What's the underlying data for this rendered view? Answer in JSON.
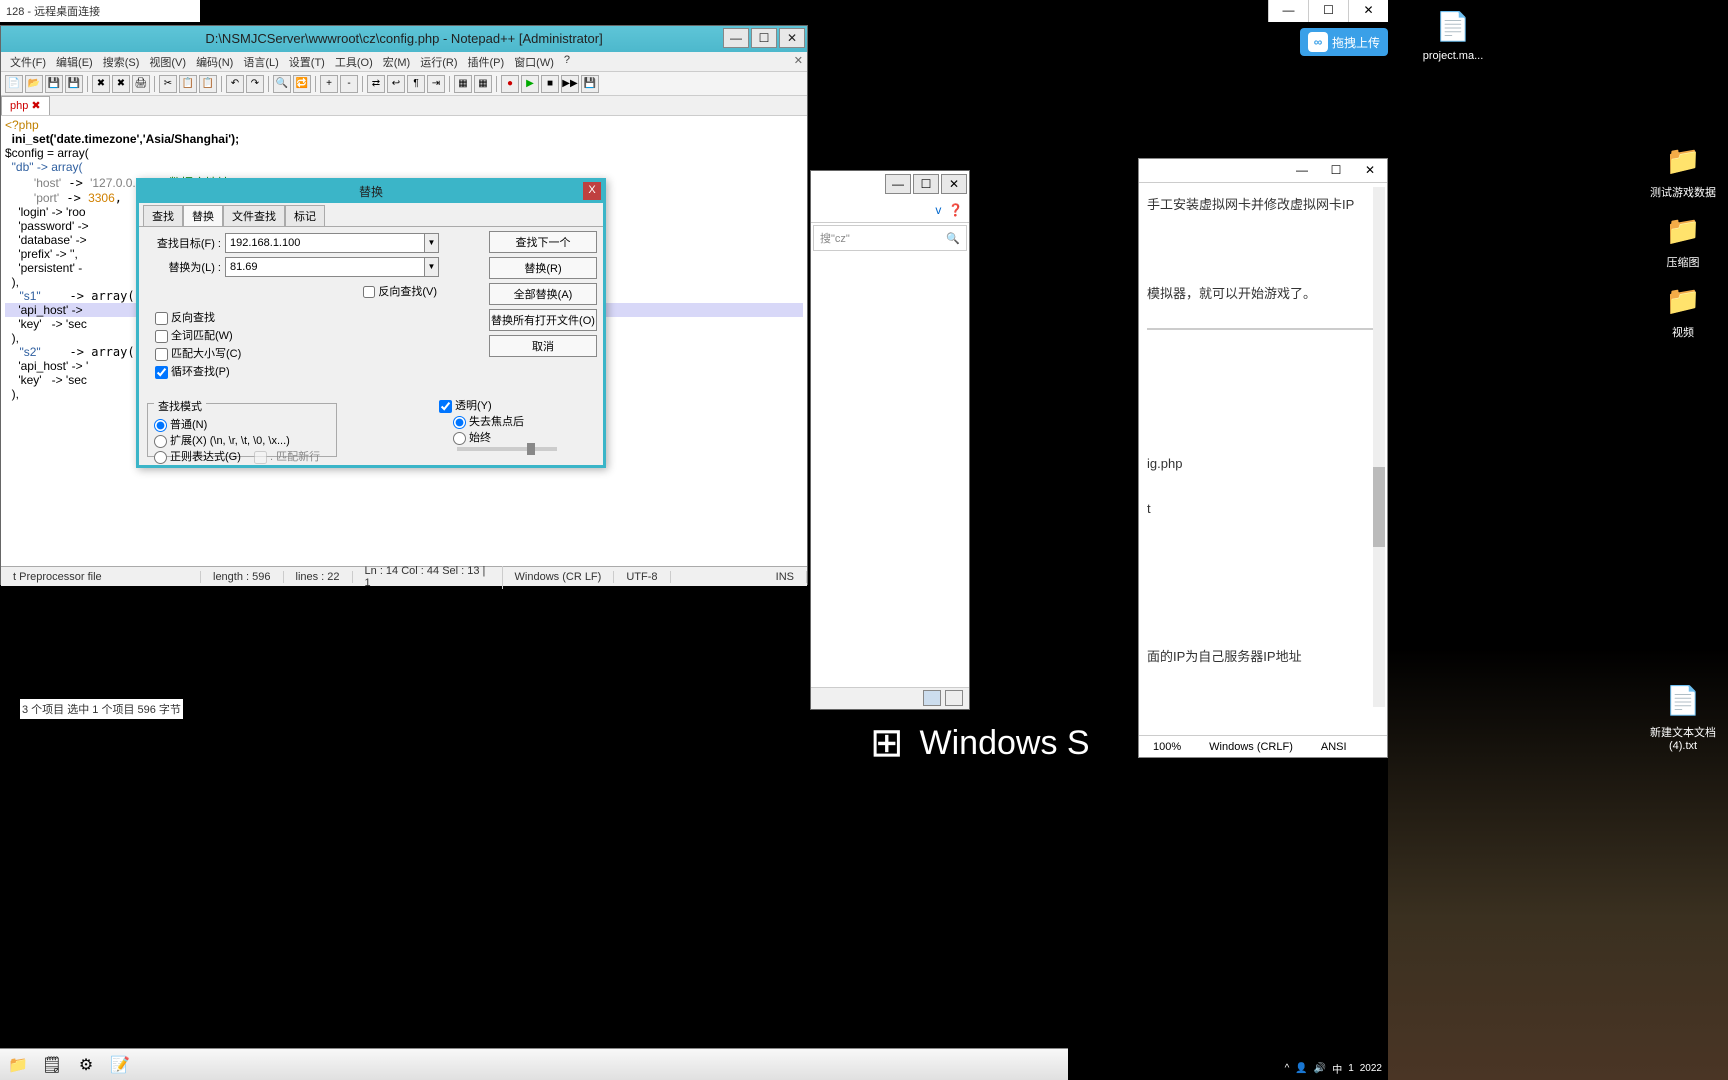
{
  "rdp": {
    "title": "128 - 远程桌面连接"
  },
  "upload": {
    "label": "拖拽上传"
  },
  "desktop_icons": {
    "project": "project.ma...",
    "test_game": "测试游戏数据",
    "compress": "压缩图",
    "video": "视频",
    "newtxt": "新建文本文档(4).txt"
  },
  "npp": {
    "title": "D:\\NSMJCServer\\wwwroot\\cz\\config.php - Notepad++ [Administrator]",
    "menus": [
      "文件(F)",
      "编辑(E)",
      "搜索(S)",
      "视图(V)",
      "编码(N)",
      "语言(L)",
      "设置(T)",
      "工具(O)",
      "宏(M)",
      "运行(R)",
      "插件(P)",
      "窗口(W)",
      "?"
    ],
    "tab": "php",
    "code": {
      "l1": "<?php",
      "l2": "  ini_set('date.timezone','Asia/Shanghai');",
      "l3": "$config = array(",
      "l4": "  \"db\" -> array(",
      "l5": "    'host' -> '127.0.0.1', // 数据库地址",
      "l6": "    'port' -> 3306,",
      "l7": "    'login' -> 'roo",
      "l8": "    'password' ->",
      "l9": "    'database' ->",
      "l10": "    'prefix' -> '',",
      "l11": "    'persistent' -",
      "l12": "  ),",
      "l13": "  \"s1\"    -> array(",
      "l14": "    'api_host' ->",
      "l15": "    'key'   -> 'sec",
      "l16": "  ),",
      "l17": "  \"s2\"    -> array(",
      "l18": "    'api_host' -> '",
      "l19": "    'key'   -> 'sec",
      "l20": "  ),"
    },
    "status": {
      "filetype": "t Preprocessor file",
      "len": "length : 596",
      "lines": "lines : 22",
      "pos": "Ln : 14   Col : 44   Sel : 13 | 1",
      "eol": "Windows (CR LF)",
      "enc": "UTF-8",
      "ins": "INS"
    }
  },
  "dlg": {
    "title": "替换",
    "tabs": [
      "查找",
      "替换",
      "文件查找",
      "标记"
    ],
    "find_label": "查找目标(F) :",
    "replace_label": "替换为(L) :",
    "find_value": "192.168.1.100",
    "replace_value": "81.69",
    "backwards": "反向查找(V)",
    "btn_findnext": "查找下一个",
    "btn_replace": "替换(R)",
    "btn_replaceall": "全部替换(A)",
    "btn_replaceallopen": "替换所有打开文件(O)",
    "btn_cancel": "取消",
    "chk_reverse": "反向查找",
    "chk_wholeword": "全词匹配(W)",
    "chk_case": "匹配大小写(C)",
    "chk_wrap": "循环查找(P)",
    "group_mode": "查找模式",
    "mode_normal": "普通(N)",
    "mode_extended": "扩展(X) (\\n, \\r, \\t, \\0, \\x...)",
    "mode_regex": "正则表达式(G)",
    "mode_dotall": ". 匹配新行",
    "chk_transparent": "透明(Y)",
    "trans_lose": "失去焦点后",
    "trans_always": "始终"
  },
  "explorer": {
    "addr_hint": "v   ❓",
    "search_hint": "搜\"cz\"",
    "status_left": "3 个项目    选中 1 个项目  596 字节"
  },
  "bgnotepad": {
    "line1": "手工安装虚拟网卡并修改虚拟网卡IP",
    "line2": "模拟器，就可以开始游戏了。",
    "line3": "ig.php",
    "line4": "t",
    "line5": "面的IP为自己服务器IP地址",
    "zoom": "100%",
    "eol": "Windows (CRLF)",
    "enc": "ANSI"
  },
  "winlogo": "Windows S",
  "tray": {
    "time": "1",
    "date": "2022"
  }
}
